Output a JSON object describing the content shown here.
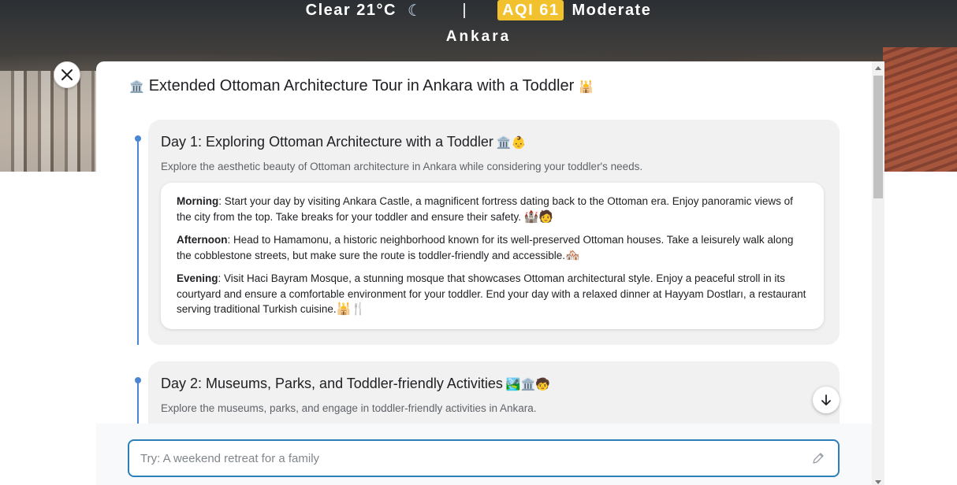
{
  "header": {
    "condition": "Clear 21°C",
    "moon_icon": "moon-icon",
    "separator": "|",
    "aqi_badge": "AQI 61",
    "aqi_label": "Moderate",
    "city": "Ankara",
    "aqi_color": "#f2c12e"
  },
  "panel": {
    "title": "Extended Ottoman Architecture Tour in Ankara with a Toddler",
    "title_icon_left": "🏛️",
    "title_icon_right": "🕌"
  },
  "days": [
    {
      "title": "Day 1: Exploring Ottoman Architecture with a Toddler",
      "title_emoji": "🏛️👶",
      "description": "Explore the aesthetic beauty of Ottoman architecture in Ankara while considering your toddler's needs.",
      "items": [
        {
          "label": "Morning",
          "text": ": Start your day by visiting Ankara Castle, a magnificent fortress dating back to the Ottoman era. Enjoy panoramic views of the city from the top. Take breaks for your toddler and ensure their safety. ",
          "emoji": "🏰🧑"
        },
        {
          "label": "Afternoon",
          "text": ": Head to Hamamonu, a historic neighborhood known for its well-preserved Ottoman houses. Take a leisurely walk along the cobblestone streets, but make sure the route is toddler-friendly and accessible.",
          "emoji": "🏘️"
        },
        {
          "label": "Evening",
          "text": ": Visit Haci Bayram Mosque, a stunning mosque that showcases Ottoman architectural style. Enjoy a peaceful stroll in its courtyard and ensure a comfortable environment for your toddler. End your day with a relaxed dinner at Hayyam Dostları, a restaurant serving traditional Turkish cuisine.",
          "emoji": "🕌🍴"
        }
      ]
    },
    {
      "title": "Day 2: Museums, Parks, and Toddler-friendly Activities",
      "title_emoji": "🏞️🏛️🧒",
      "description": "Explore the museums, parks, and engage in toddler-friendly activities in Ankara."
    }
  ],
  "input": {
    "placeholder": "Try: A weekend retreat for a family",
    "value": ""
  },
  "accent_color": "#4a86d4"
}
